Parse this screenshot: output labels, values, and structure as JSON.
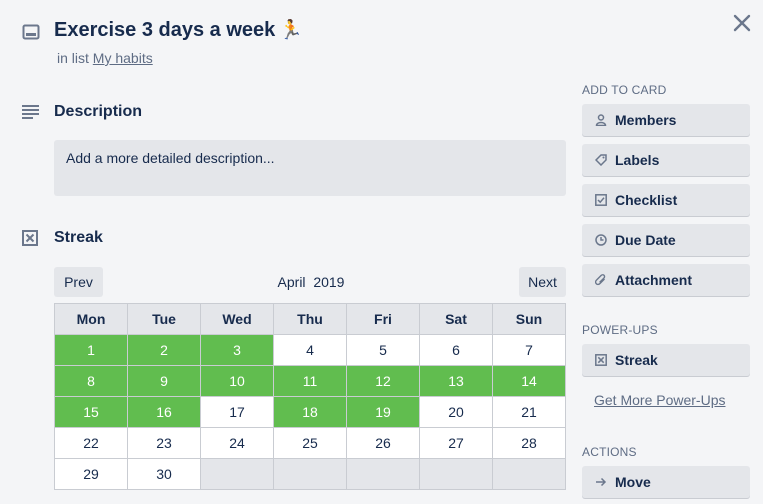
{
  "card": {
    "title": "Exercise 3 days a week",
    "title_emoji": "🏃",
    "in_list_prefix": "in list",
    "list_name": "My habits"
  },
  "description": {
    "heading": "Description",
    "placeholder": "Add a more detailed description..."
  },
  "streak": {
    "heading": "Streak",
    "prev_label": "Prev",
    "next_label": "Next",
    "month_label": "April  2019",
    "weekdays": [
      "Mon",
      "Tue",
      "Wed",
      "Thu",
      "Fri",
      "Sat",
      "Sun"
    ],
    "weeks": [
      [
        {
          "day": "1",
          "done": true
        },
        {
          "day": "2",
          "done": true
        },
        {
          "day": "3",
          "done": true
        },
        {
          "day": "4",
          "done": false
        },
        {
          "day": "5",
          "done": false
        },
        {
          "day": "6",
          "done": false
        },
        {
          "day": "7",
          "done": false
        }
      ],
      [
        {
          "day": "8",
          "done": true
        },
        {
          "day": "9",
          "done": true
        },
        {
          "day": "10",
          "done": true
        },
        {
          "day": "11",
          "done": true
        },
        {
          "day": "12",
          "done": true
        },
        {
          "day": "13",
          "done": true
        },
        {
          "day": "14",
          "done": true
        }
      ],
      [
        {
          "day": "15",
          "done": true
        },
        {
          "day": "16",
          "done": true
        },
        {
          "day": "17",
          "done": false
        },
        {
          "day": "18",
          "done": true
        },
        {
          "day": "19",
          "done": true
        },
        {
          "day": "20",
          "done": false
        },
        {
          "day": "21",
          "done": false
        }
      ],
      [
        {
          "day": "22",
          "done": false
        },
        {
          "day": "23",
          "done": false
        },
        {
          "day": "24",
          "done": false
        },
        {
          "day": "25",
          "done": false
        },
        {
          "day": "26",
          "done": false
        },
        {
          "day": "27",
          "done": false
        },
        {
          "day": "28",
          "done": false
        }
      ],
      [
        {
          "day": "29",
          "done": false
        },
        {
          "day": "30",
          "done": false
        },
        null,
        null,
        null,
        null,
        null
      ]
    ]
  },
  "sidebar": {
    "add_to_card_heading": "ADD TO CARD",
    "members_label": "Members",
    "labels_label": "Labels",
    "checklist_label": "Checklist",
    "due_date_label": "Due Date",
    "attachment_label": "Attachment",
    "power_ups_heading": "POWER-UPS",
    "streak_label": "Streak",
    "get_more_label": "Get More Power-Ups",
    "actions_heading": "ACTIONS",
    "move_label": "Move"
  },
  "colors": {
    "done_green": "#61bd4f",
    "button_gray": "#e4e6ea",
    "text_dark": "#172b4d",
    "text_muted": "#5e6c84"
  }
}
